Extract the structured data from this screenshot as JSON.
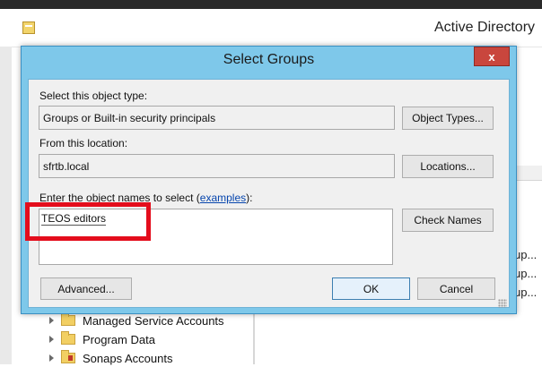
{
  "background_window": {
    "title": "Active Directory",
    "right_pane_items": [
      "up...",
      "up...",
      "up..."
    ],
    "tree_items": [
      {
        "label": "Managed Service Accounts",
        "icon": "folder-icon"
      },
      {
        "label": "Program Data",
        "icon": "folder-icon"
      },
      {
        "label": "Sonaps Accounts",
        "icon": "special-folder-icon"
      }
    ]
  },
  "dialog": {
    "title": "Select Groups",
    "close_label": "x",
    "object_type": {
      "label": "Select this object type:",
      "value": "Groups or Built-in security principals",
      "button": "Object Types..."
    },
    "location": {
      "label": "From this location:",
      "value": "sfrtb.local",
      "button": "Locations..."
    },
    "names": {
      "label_prefix": "Enter the object names to select (",
      "label_link": "examples",
      "label_suffix": "):",
      "value": "TEOS editors",
      "button": "Check Names"
    },
    "buttons": {
      "advanced": "Advanced...",
      "ok": "OK",
      "cancel": "Cancel"
    }
  },
  "colors": {
    "dialog_frame": "#7ec8ea",
    "close_button": "#c9463d",
    "highlight": "#e40d1c"
  }
}
